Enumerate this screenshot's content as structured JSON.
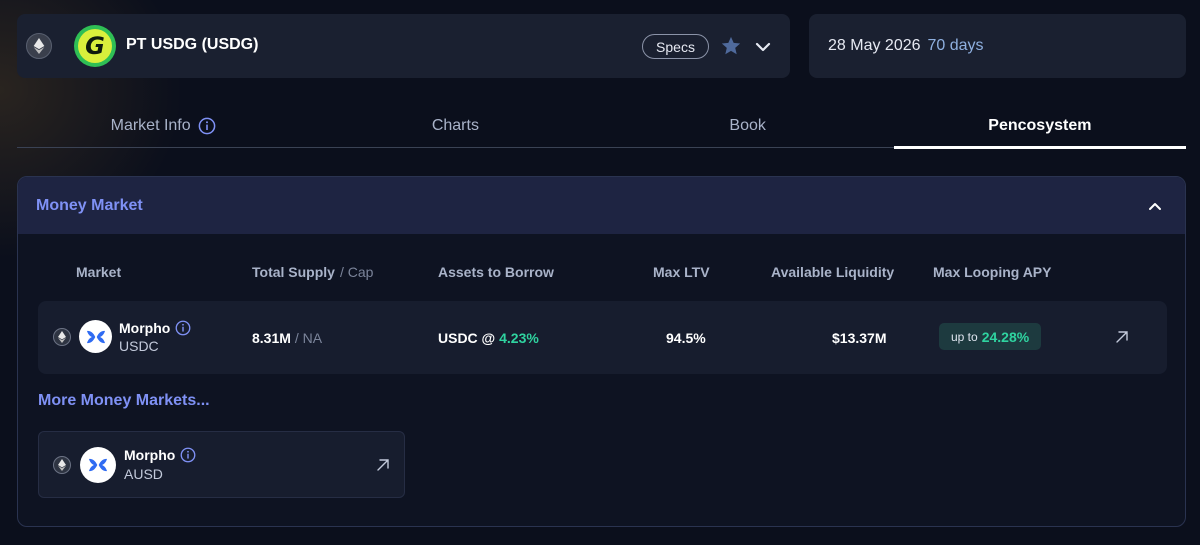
{
  "header": {
    "token_name": "PT USDG (USDG)",
    "token_logo_letter": "G",
    "specs_label": "Specs",
    "chain_icon": "ethereum-icon",
    "favorite_icon": "star-icon",
    "expand_icon": "chevron-down-icon"
  },
  "maturity": {
    "date": "28 May 2026",
    "days_left": "70 days"
  },
  "tabs": [
    {
      "label": "Market Info",
      "active": false,
      "has_info_icon": true
    },
    {
      "label": "Charts",
      "active": false
    },
    {
      "label": "Book",
      "active": false
    },
    {
      "label": "Pencosystem",
      "active": true
    }
  ],
  "money_market": {
    "title": "Money Market",
    "columns": {
      "market": "Market",
      "total_supply": "Total Supply",
      "cap": "/ Cap",
      "assets_to_borrow": "Assets to Borrow",
      "max_ltv": "Max LTV",
      "available_liquidity": "Available Liquidity",
      "max_looping_apy": "Max Looping APY"
    },
    "rows": [
      {
        "protocol": "Morpho",
        "asset": "USDC",
        "total_supply": "8.31M",
        "cap": "/ NA",
        "borrow_asset": "USDC @",
        "borrow_rate": "4.23%",
        "max_ltv": "94.5%",
        "available_liquidity": "$13.37M",
        "apy_prefix": "up to",
        "apy_value": "24.28%"
      }
    ],
    "more_title": "More Money Markets...",
    "more": [
      {
        "protocol": "Morpho",
        "asset": "AUSD"
      }
    ]
  },
  "colors": {
    "accent": "#7f91f5",
    "positive": "#2fd3a0",
    "card": "#1a2030",
    "background": "#0b0f1c"
  }
}
